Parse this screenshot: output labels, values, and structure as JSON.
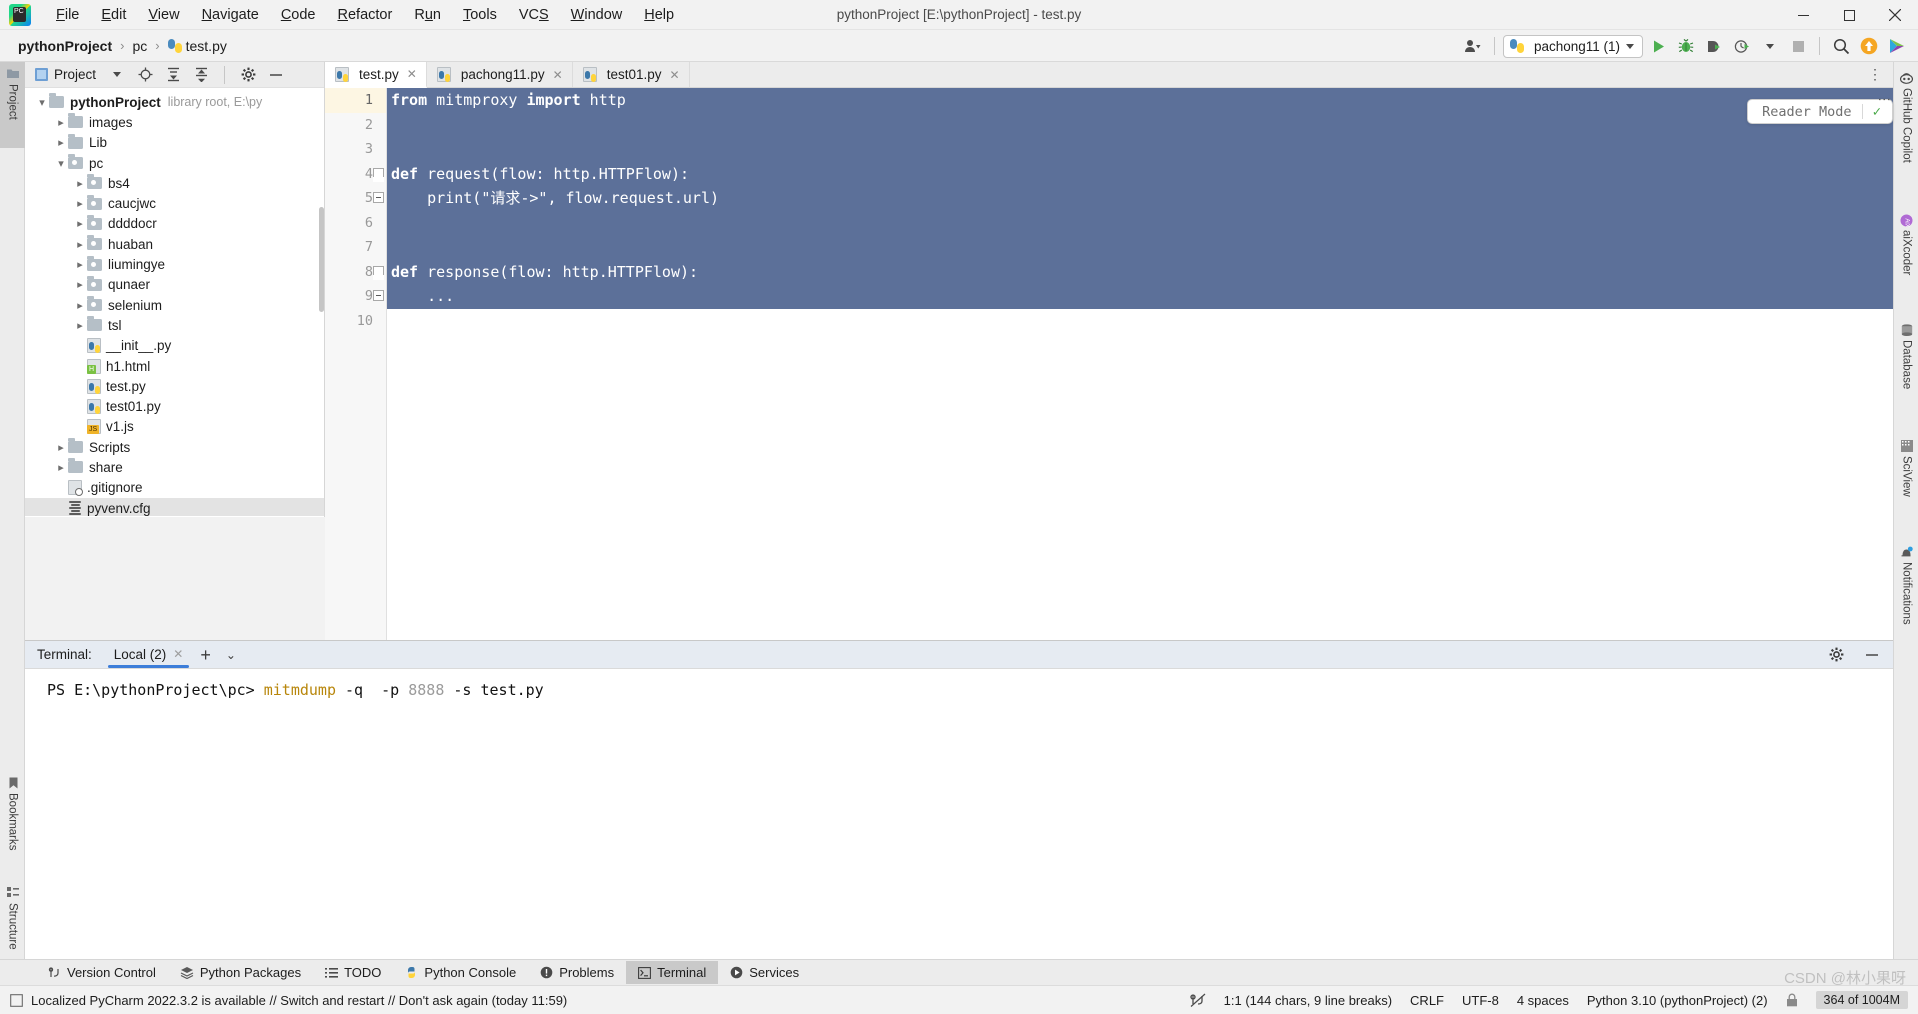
{
  "window": {
    "title": "pythonProject [E:\\pythonProject] - test.py",
    "minimize": "—",
    "maximize": "❐",
    "close": "✕"
  },
  "menubar": [
    {
      "label": "File",
      "mnemonic": "F"
    },
    {
      "label": "Edit",
      "mnemonic": "E"
    },
    {
      "label": "View",
      "mnemonic": "V"
    },
    {
      "label": "Navigate",
      "mnemonic": "N"
    },
    {
      "label": "Code",
      "mnemonic": "C"
    },
    {
      "label": "Refactor",
      "mnemonic": "R"
    },
    {
      "label": "Run",
      "mnemonic": "u"
    },
    {
      "label": "Tools",
      "mnemonic": "T"
    },
    {
      "label": "VCS",
      "mnemonic": "S"
    },
    {
      "label": "Window",
      "mnemonic": "W"
    },
    {
      "label": "Help",
      "mnemonic": "H"
    }
  ],
  "breadcrumb": {
    "project": "pythonProject",
    "folder": "pc",
    "file": "test.py",
    "separator": "›"
  },
  "toolbar": {
    "run_config": "pachong11 (1)",
    "run_icon": "run-icon",
    "debug_icon": "debug-icon",
    "coverage_icon": "coverage-icon",
    "profile_icon": "profile-icon",
    "stop_icon": "stop-icon",
    "search_icon": "search-everywhere-icon",
    "update_icon": "update-project-icon",
    "copilot_icon": "copilot-icon",
    "account_icon": "account-icon"
  },
  "left_stripe": [
    {
      "label": "Project",
      "icon": "project-folder-icon",
      "active": true
    },
    {
      "label": "Bookmarks",
      "icon": "bookmark-icon",
      "active": false
    },
    {
      "label": "Structure",
      "icon": "structure-icon",
      "active": false
    }
  ],
  "right_stripe": [
    {
      "label": "GitHub Copilot",
      "icon": "copilot-icon"
    },
    {
      "label": "aiXcoder",
      "icon": "aixcoder-icon"
    },
    {
      "label": "Database",
      "icon": "database-icon"
    },
    {
      "label": "SciView",
      "icon": "sciview-icon"
    },
    {
      "label": "Notifications",
      "icon": "notifications-icon"
    }
  ],
  "project_panel": {
    "title": "Project",
    "icons": [
      "chevron-down-icon",
      "locate-icon",
      "expand-all-icon",
      "collapse-all-icon",
      "settings-icon",
      "hide-icon"
    ],
    "tree": [
      {
        "label": "pythonProject",
        "note": "library root, E:\\py",
        "depth": 0,
        "type": "folder",
        "state": "expanded",
        "bold": true
      },
      {
        "label": "images",
        "depth": 1,
        "type": "folder",
        "state": "collapsed"
      },
      {
        "label": "Lib",
        "depth": 1,
        "type": "folder",
        "state": "collapsed"
      },
      {
        "label": "pc",
        "depth": 1,
        "type": "folder-src",
        "state": "expanded"
      },
      {
        "label": "bs4",
        "depth": 2,
        "type": "folder-src",
        "state": "collapsed"
      },
      {
        "label": "caucjwc",
        "depth": 2,
        "type": "folder-src",
        "state": "collapsed"
      },
      {
        "label": "ddddocr",
        "depth": 2,
        "type": "folder-src",
        "state": "collapsed"
      },
      {
        "label": "huaban",
        "depth": 2,
        "type": "folder-src",
        "state": "collapsed"
      },
      {
        "label": "liumingye",
        "depth": 2,
        "type": "folder-src",
        "state": "collapsed"
      },
      {
        "label": "qunaer",
        "depth": 2,
        "type": "folder-src",
        "state": "collapsed"
      },
      {
        "label": "selenium",
        "depth": 2,
        "type": "folder-src",
        "state": "collapsed"
      },
      {
        "label": "tsl",
        "depth": 2,
        "type": "folder",
        "state": "collapsed"
      },
      {
        "label": "__init__.py",
        "depth": 2,
        "type": "python",
        "state": "leaf"
      },
      {
        "label": "h1.html",
        "depth": 2,
        "type": "html",
        "state": "leaf"
      },
      {
        "label": "test.py",
        "depth": 2,
        "type": "python",
        "state": "leaf"
      },
      {
        "label": "test01.py",
        "depth": 2,
        "type": "python",
        "state": "leaf"
      },
      {
        "label": "v1.js",
        "depth": 2,
        "type": "js",
        "state": "leaf"
      },
      {
        "label": "Scripts",
        "depth": 1,
        "type": "folder",
        "state": "collapsed"
      },
      {
        "label": "share",
        "depth": 1,
        "type": "folder",
        "state": "collapsed"
      },
      {
        "label": ".gitignore",
        "depth": 1,
        "type": "gitignore",
        "state": "leaf"
      },
      {
        "label": "pyvenv.cfg",
        "depth": 1,
        "type": "cfg",
        "state": "leaf",
        "selected": true
      }
    ]
  },
  "editor": {
    "tabs": [
      {
        "label": "test.py",
        "active": true,
        "icon": "python-file-icon"
      },
      {
        "label": "pachong11.py",
        "active": false,
        "icon": "python-file-icon"
      },
      {
        "label": "test01.py",
        "active": false,
        "icon": "python-file-icon"
      }
    ],
    "reader_mode": {
      "label": "Reader Mode",
      "check": "✓"
    },
    "line_numbers": [
      "1",
      "2",
      "3",
      "4",
      "5",
      "6",
      "7",
      "8",
      "9",
      "10"
    ],
    "lines": [
      {
        "n": 1,
        "selected": true,
        "tokens": [
          {
            "t": "from",
            "c": "kw"
          },
          {
            "t": " mitmproxy ",
            "c": ""
          },
          {
            "t": "import",
            "c": "kw"
          },
          {
            "t": " http",
            "c": ""
          }
        ]
      },
      {
        "n": 2,
        "selected": true,
        "tokens": [
          {
            "t": "",
            "c": ""
          }
        ]
      },
      {
        "n": 3,
        "selected": true,
        "tokens": [
          {
            "t": "",
            "c": ""
          }
        ]
      },
      {
        "n": 4,
        "selected": true,
        "fold": "arrow",
        "tokens": [
          {
            "t": "def",
            "c": "kw"
          },
          {
            "t": " request(flow: http.HTTPFlow):",
            "c": ""
          }
        ]
      },
      {
        "n": 5,
        "selected": true,
        "fold": "minus",
        "tokens": [
          {
            "t": "    print(",
            "c": ""
          },
          {
            "t": "\"请求->\"",
            "c": "str"
          },
          {
            "t": ", flow.request.url)",
            "c": ""
          }
        ]
      },
      {
        "n": 6,
        "selected": true,
        "tokens": [
          {
            "t": "",
            "c": ""
          }
        ]
      },
      {
        "n": 7,
        "selected": true,
        "tokens": [
          {
            "t": "",
            "c": ""
          }
        ]
      },
      {
        "n": 8,
        "selected": true,
        "fold": "arrow",
        "tokens": [
          {
            "t": "def",
            "c": "kw"
          },
          {
            "t": " response(flow: http.HTTPFlow):",
            "c": ""
          }
        ]
      },
      {
        "n": 9,
        "selected": true,
        "fold": "minus",
        "tokens": [
          {
            "t": "    ...",
            "c": ""
          }
        ]
      },
      {
        "n": 10,
        "selected": false,
        "tokens": [
          {
            "t": "",
            "c": ""
          }
        ]
      }
    ]
  },
  "terminal": {
    "label": "Terminal:",
    "tab": "Local (2)",
    "add_icon": "add-tab-icon",
    "dropdown_icon": "chevron-down-icon",
    "settings_icon": "settings-icon",
    "hide_icon": "hide-icon",
    "prompt": "PS E:\\pythonProject\\pc>",
    "cmd_parts": [
      {
        "t": "mitmdump",
        "c": "t-cmd"
      },
      {
        "t": " -q  -p ",
        "c": ""
      },
      {
        "t": "8888",
        "c": "t-dim"
      },
      {
        "t": " -s test.py",
        "c": ""
      }
    ]
  },
  "toolwindow_bar": [
    {
      "label": "Version Control",
      "icon": "branch-icon",
      "active": false
    },
    {
      "label": "Python Packages",
      "icon": "packages-icon",
      "active": false
    },
    {
      "label": "TODO",
      "icon": "todo-icon",
      "active": false
    },
    {
      "label": "Python Console",
      "icon": "python-console-icon",
      "active": false
    },
    {
      "label": "Problems",
      "icon": "problems-icon",
      "active": false
    },
    {
      "label": "Terminal",
      "icon": "terminal-icon",
      "active": true
    },
    {
      "label": "Services",
      "icon": "services-icon",
      "active": false
    }
  ],
  "statusbar": {
    "message": "Localized PyCharm 2022.3.2 is available // Switch and restart // Don't ask again (today 11:59)",
    "message_icon": "notification-icon",
    "caret": "1:1 (144 chars, 9 line breaks)",
    "line_sep": "CRLF",
    "encoding": "UTF-8",
    "indent": "4 spaces",
    "interpreter": "Python 3.10 (pythonProject) (2)",
    "memory": "364 of 1004M",
    "vcs_icon": "no-vcs-icon",
    "lock_icon": "lock-icon"
  },
  "watermark": "CSDN @林小果呀",
  "colors": {
    "selection_bg": "#5c7099",
    "accent_blue": "#3c7dd9",
    "keyword": "#0033b3",
    "string": "#067d17",
    "terminal_cmd": "#b8860b",
    "chrome_bg": "#f2f2f2",
    "panel_bg": "#ececec",
    "terminal_head_bg": "#e6ebf2"
  }
}
